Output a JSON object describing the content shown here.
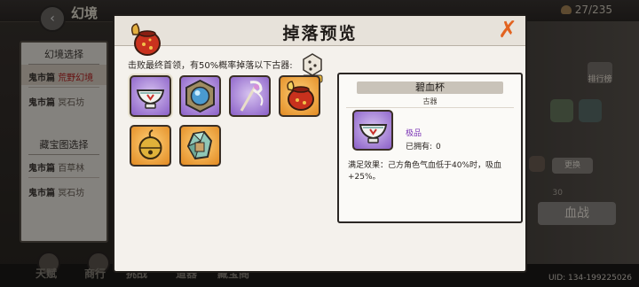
{
  "background": {
    "title": "幻境",
    "coins": "27/235",
    "back_icon": "back-arrow-icon",
    "left_panel": {
      "heading_1": "幻境选择",
      "items_1": [
        {
          "name": "鬼市篇",
          "sub": "荒野幻境",
          "selected": true
        },
        {
          "name": "鬼市篇",
          "sub": "冥石坊",
          "selected": false
        }
      ],
      "heading_2": "藏宝图选择",
      "items_2": [
        {
          "name": "鬼市篇",
          "sub": "百草林"
        },
        {
          "name": "鬼市篇",
          "sub": "冥石坊"
        }
      ]
    },
    "rank_label": "排行榜",
    "side_btn_label": "更换",
    "number_label": "30",
    "fight_label": "血战",
    "bottom_nav": [
      "天赋",
      "商行",
      "挑战",
      "道器",
      "藏宝阁"
    ],
    "uid": "UID: 134-199225026"
  },
  "modal": {
    "title": "掉落预览",
    "close_icon": "close-x-icon",
    "description": "击败最终首领，有50%概率掉落以下古器:",
    "prob_badge_icon": "probability-dice-icon",
    "items": [
      {
        "name": "碧血杯",
        "rarity": "purple",
        "icon": "bowl-icon",
        "selected": true
      },
      {
        "name": "",
        "rarity": "purple",
        "icon": "orb-icon",
        "selected": false
      },
      {
        "name": "",
        "rarity": "purple",
        "icon": "staff-icon",
        "selected": false
      },
      {
        "name": "",
        "rarity": "orange",
        "icon": "pouch-icon",
        "selected": false
      },
      {
        "name": "",
        "rarity": "orange",
        "icon": "bell-icon",
        "selected": false
      },
      {
        "name": "",
        "rarity": "orange",
        "icon": "crystal-icon",
        "selected": false
      }
    ],
    "detail": {
      "name": "碧血杯",
      "type": "古器",
      "grade": "极品",
      "owned_label": "已拥有:",
      "owned_value": "0",
      "effect": "满足效果：己方角色气血低于40%时，吸血+25%。"
    }
  },
  "colors": {
    "purple_slot": "#8a5fc7",
    "orange_slot": "#e28a22",
    "close": "#e26320",
    "grade": "#7a33b5"
  }
}
